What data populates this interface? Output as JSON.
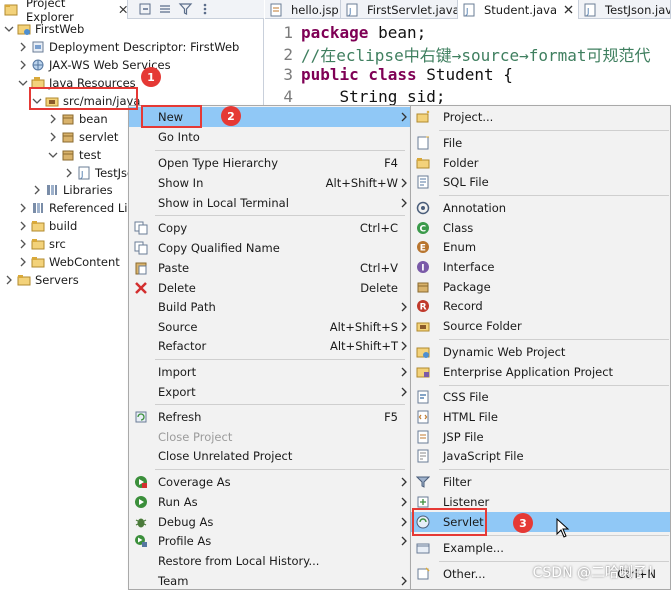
{
  "explorer": {
    "title": "Project Explorer",
    "tree": [
      {
        "label": "FirstWeb"
      },
      {
        "label": "Deployment Descriptor: FirstWeb"
      },
      {
        "label": "JAX-WS Web Services"
      },
      {
        "label": "Java Resources"
      },
      {
        "label": "src/main/java"
      },
      {
        "label": "bean"
      },
      {
        "label": "servlet"
      },
      {
        "label": "test"
      },
      {
        "label": "TestJson"
      },
      {
        "label": "Libraries"
      },
      {
        "label": "Referenced Lib"
      },
      {
        "label": "build"
      },
      {
        "label": "src"
      },
      {
        "label": "WebContent"
      },
      {
        "label": "Servers"
      }
    ]
  },
  "editor": {
    "tabs": [
      {
        "label": "hello.jsp"
      },
      {
        "label": "FirstServlet.java"
      },
      {
        "label": "Student.java"
      },
      {
        "label": "TestJson.java"
      }
    ],
    "lines": [
      {
        "num": "1",
        "kw": "package",
        "text": " bean;"
      },
      {
        "num": "2",
        "comment": "//在eclipse中右键→source→format可规范代"
      },
      {
        "num": "3",
        "kw": "public class",
        "text": " Student {"
      },
      {
        "num": "4",
        "text": "    String sid;"
      }
    ]
  },
  "context_menu": {
    "items": [
      {
        "label": "New",
        "shortcut": ""
      },
      {
        "label": "Go Into",
        "shortcut": ""
      },
      {
        "label": "Open Type Hierarchy",
        "shortcut": "F4"
      },
      {
        "label": "Show In",
        "shortcut": "Alt+Shift+W"
      },
      {
        "label": "Show in Local Terminal",
        "shortcut": ""
      },
      {
        "label": "Copy",
        "shortcut": "Ctrl+C"
      },
      {
        "label": "Copy Qualified Name",
        "shortcut": ""
      },
      {
        "label": "Paste",
        "shortcut": "Ctrl+V"
      },
      {
        "label": "Delete",
        "shortcut": "Delete"
      },
      {
        "label": "Build Path",
        "shortcut": ""
      },
      {
        "label": "Source",
        "shortcut": "Alt+Shift+S"
      },
      {
        "label": "Refactor",
        "shortcut": "Alt+Shift+T"
      },
      {
        "label": "Import",
        "shortcut": ""
      },
      {
        "label": "Export",
        "shortcut": ""
      },
      {
        "label": "Refresh",
        "shortcut": "F5"
      },
      {
        "label": "Close Project",
        "shortcut": ""
      },
      {
        "label": "Close Unrelated Project",
        "shortcut": ""
      },
      {
        "label": "Coverage As",
        "shortcut": ""
      },
      {
        "label": "Run As",
        "shortcut": ""
      },
      {
        "label": "Debug As",
        "shortcut": ""
      },
      {
        "label": "Profile As",
        "shortcut": ""
      },
      {
        "label": "Restore from Local History...",
        "shortcut": ""
      },
      {
        "label": "Team",
        "shortcut": ""
      }
    ]
  },
  "new_submenu": {
    "items": [
      {
        "label": "Project..."
      },
      {
        "label": "File"
      },
      {
        "label": "Folder"
      },
      {
        "label": "SQL File"
      },
      {
        "label": "Annotation"
      },
      {
        "label": "Class"
      },
      {
        "label": "Enum"
      },
      {
        "label": "Interface"
      },
      {
        "label": "Package"
      },
      {
        "label": "Record"
      },
      {
        "label": "Source Folder"
      },
      {
        "label": "Dynamic Web Project"
      },
      {
        "label": "Enterprise Application Project"
      },
      {
        "label": "CSS File"
      },
      {
        "label": "HTML File"
      },
      {
        "label": "JSP File"
      },
      {
        "label": "JavaScript File"
      },
      {
        "label": "Filter"
      },
      {
        "label": "Listener"
      },
      {
        "label": "Servlet"
      },
      {
        "label": "Example..."
      },
      {
        "label": "Other...",
        "shortcut": "Ctrl+N"
      }
    ]
  },
  "annotations": {
    "badge1": "1",
    "badge2": "2",
    "badge3": "3"
  },
  "watermark": "CSDN @二哈喇子！",
  "colors": {
    "highlight": "#90c8f6",
    "annotation_red": "#e53935",
    "keyword": "#7f0055",
    "comment": "#3f7f5f",
    "menu_bg": "#f2f2f2"
  }
}
